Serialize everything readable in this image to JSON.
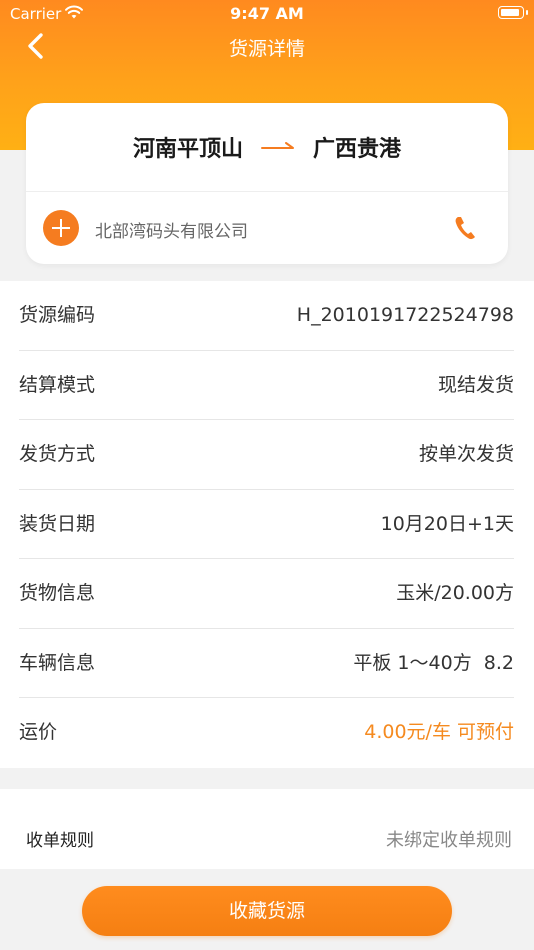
{
  "status_bar": {
    "carrier": "Carrier",
    "time": "9:47 AM"
  },
  "nav": {
    "title": "货源详情",
    "back_icon": "chevron-left-icon"
  },
  "route": {
    "from": "河南平顶山",
    "to": "广西贵港",
    "company": "北部湾码头有限公司"
  },
  "details": [
    {
      "label": "货源编码",
      "value": "H_2010191722524798"
    },
    {
      "label": "结算模式",
      "value": "现结发货"
    },
    {
      "label": "发货方式",
      "value": "按单次发货"
    },
    {
      "label": "装货日期",
      "value": "10月20日+1天"
    },
    {
      "label": "货物信息",
      "value": "玉米/20.00方"
    },
    {
      "label": "车辆信息",
      "value": "平板 1～40方  8.2"
    },
    {
      "label": "运价",
      "value": "4.00元/车 可预付"
    }
  ],
  "rules": {
    "label": "收单规则",
    "value": "未绑定收单规则"
  },
  "action": {
    "collect_label": "收藏货源"
  },
  "colors": {
    "accent": "#f57c20",
    "header_top": "#ff8a1f",
    "header_bottom": "#ffb014"
  }
}
